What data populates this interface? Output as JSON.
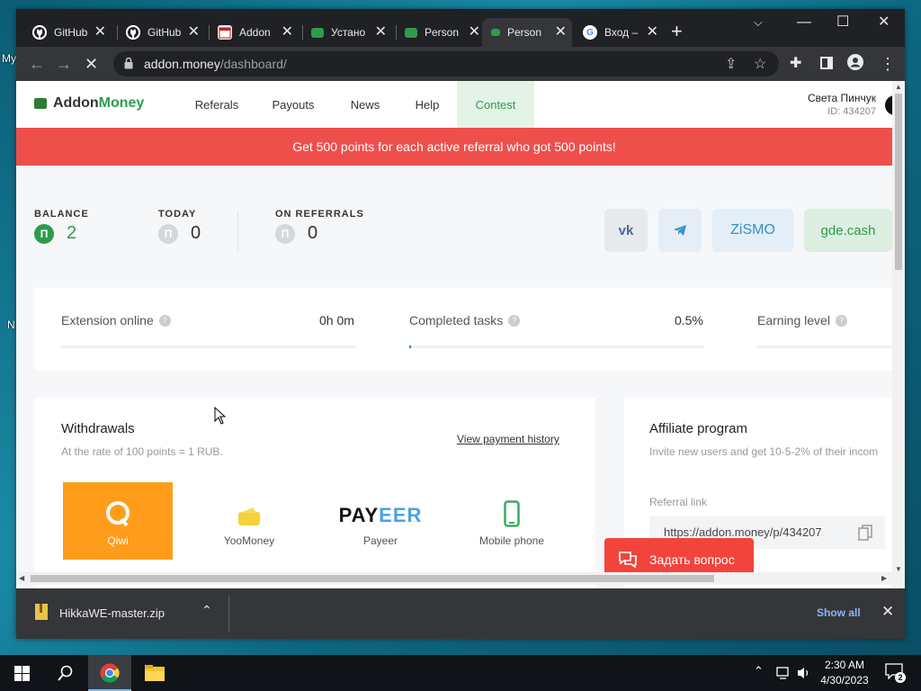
{
  "desktop": {
    "icon_labels": [
      "My",
      "N"
    ]
  },
  "browser": {
    "tabs": [
      {
        "title": "GitHub",
        "icon": "github-icon"
      },
      {
        "title": "GitHub",
        "icon": "github-icon"
      },
      {
        "title": "Addon",
        "icon": "calendar-icon"
      },
      {
        "title": "Устано",
        "icon": "wallet-icon"
      },
      {
        "title": "Person",
        "icon": "wallet-icon"
      },
      {
        "title": "Person",
        "icon": "wallet-icon",
        "active": true
      },
      {
        "title": "Вход –",
        "icon": "google-icon"
      }
    ],
    "url_host": "addon.money",
    "url_path": "/dashboard/"
  },
  "site": {
    "logo_a": "Addon",
    "logo_b": "Money",
    "nav": [
      "Referals",
      "Payouts",
      "News",
      "Help",
      "Contest"
    ],
    "user_name": "Света Пинчук",
    "user_id": "ID: 434207",
    "promo": "Get 500 points for each active referral who got 500 points!"
  },
  "stats": {
    "balance_label": "BALANCE",
    "balance_value": "2",
    "today_label": "TODAY",
    "today_value": "0",
    "referrals_label": "ON REFERRALS",
    "referrals_value": "0",
    "coin_symbol": "П"
  },
  "socials": {
    "vk": "vk",
    "telegram": "telegram",
    "zismo": "ZiSMO",
    "gdecash": "gde.cash"
  },
  "metrics": {
    "ext_label": "Extension online",
    "ext_value": "0h 0m",
    "tasks_label": "Completed tasks",
    "tasks_value": "0.5%",
    "tasks_progress": 0.005,
    "level_label": "Earning level",
    "help": "?"
  },
  "withdrawals": {
    "title": "Withdrawals",
    "subtitle": "At the rate of 100 points = 1 RUB.",
    "history_link": "View payment history",
    "methods": [
      "Qiwi",
      "YooMoney",
      "Payeer",
      "Mobile phone"
    ],
    "payeer_logo_a": "PAY",
    "payeer_logo_b": "EER"
  },
  "affiliate": {
    "title": "Affiliate program",
    "subtitle": "Invite new users and get 10-5-2% of their incom",
    "ref_label": "Referral link",
    "ref_url": "https://addon.money/p/434207"
  },
  "chat": {
    "label": "Задать вопрос"
  },
  "download": {
    "filename": "HikkaWE-master.zip",
    "show_all": "Show all"
  },
  "taskbar": {
    "time": "2:30 AM",
    "date": "4/30/2023",
    "notifications": "2"
  },
  "colors": {
    "brand_green": "#2e9b4f",
    "promo_red": "#ee4f4b",
    "qiwi_orange": "#ff9c1a",
    "chat_red": "#f2443d"
  }
}
